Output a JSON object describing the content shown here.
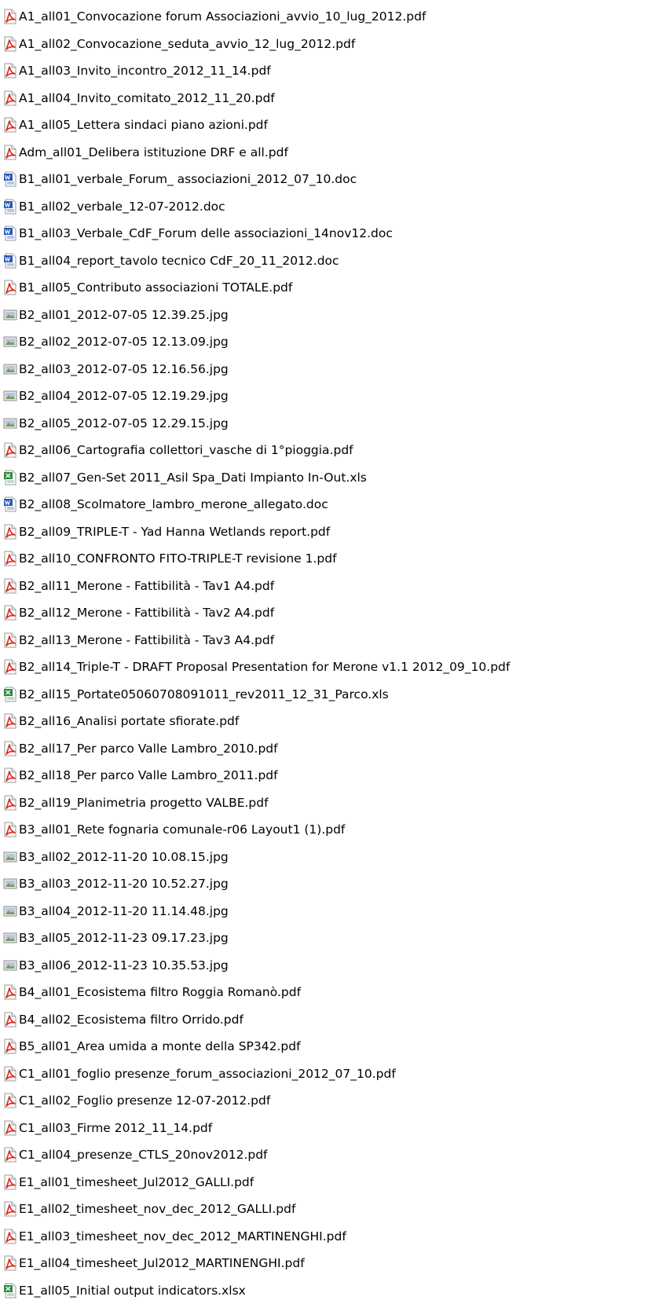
{
  "files": [
    {
      "name": "A1_all01_Convocazione forum Associazioni_avvio_10_lug_2012.pdf",
      "icon": "pdf-icon"
    },
    {
      "name": "A1_all02_Convocazione_seduta_avvio_12_lug_2012.pdf",
      "icon": "pdf-icon"
    },
    {
      "name": "A1_all03_Invito_incontro_2012_11_14.pdf",
      "icon": "pdf-icon"
    },
    {
      "name": "A1_all04_Invito_comitato_2012_11_20.pdf",
      "icon": "pdf-icon"
    },
    {
      "name": "A1_all05_Lettera sindaci piano azioni.pdf",
      "icon": "pdf-icon"
    },
    {
      "name": "Adm_all01_Delibera istituzione DRF e all.pdf",
      "icon": "pdf-icon"
    },
    {
      "name": "B1_all01_verbale_Forum_ associazioni_2012_07_10.doc",
      "icon": "word-doc-icon"
    },
    {
      "name": "B1_all02_verbale_12-07-2012.doc",
      "icon": "word-doc-icon"
    },
    {
      "name": "B1_all03_Verbale_CdF_Forum delle associazioni_14nov12.doc",
      "icon": "word-doc-icon"
    },
    {
      "name": "B1_all04_report_tavolo tecnico CdF_20_11_2012.doc",
      "icon": "word-doc-icon"
    },
    {
      "name": "B1_all05_Contributo associazioni TOTALE.pdf",
      "icon": "pdf-icon"
    },
    {
      "name": "B2_all01_2012-07-05 12.39.25.jpg",
      "icon": "image-icon"
    },
    {
      "name": "B2_all02_2012-07-05 12.13.09.jpg",
      "icon": "image-icon"
    },
    {
      "name": "B2_all03_2012-07-05 12.16.56.jpg",
      "icon": "image-icon"
    },
    {
      "name": "B2_all04_2012-07-05 12.19.29.jpg",
      "icon": "image-icon"
    },
    {
      "name": "B2_all05_2012-07-05 12.29.15.jpg",
      "icon": "image-icon"
    },
    {
      "name": "B2_all06_Cartografia collettori_vasche di 1°pioggia.pdf",
      "icon": "pdf-icon"
    },
    {
      "name": "B2_all07_Gen-Set 2011_Asil Spa_Dati Impianto In-Out.xls",
      "icon": "excel-icon"
    },
    {
      "name": "B2_all08_Scolmatore_lambro_merone_allegato.doc",
      "icon": "word-doc-icon"
    },
    {
      "name": "B2_all09_TRIPLE-T - Yad Hanna Wetlands report.pdf",
      "icon": "pdf-icon"
    },
    {
      "name": "B2_all10_CONFRONTO  FITO-TRIPLE-T  revisione 1.pdf",
      "icon": "pdf-icon"
    },
    {
      "name": "B2_all11_Merone - Fattibilità - Tav1 A4.pdf",
      "icon": "pdf-icon"
    },
    {
      "name": "B2_all12_Merone - Fattibilità - Tav2 A4.pdf",
      "icon": "pdf-icon"
    },
    {
      "name": "B2_all13_Merone - Fattibilità - Tav3 A4.pdf",
      "icon": "pdf-icon"
    },
    {
      "name": "B2_all14_Triple-T - DRAFT Proposal Presentation for Merone v1.1 2012_09_10.pdf",
      "icon": "pdf-icon"
    },
    {
      "name": "B2_all15_Portate05060708091011_rev2011_12_31_Parco.xls",
      "icon": "excel-icon"
    },
    {
      "name": "B2_all16_Analisi portate sfiorate.pdf",
      "icon": "pdf-icon"
    },
    {
      "name": "B2_all17_Per parco Valle Lambro_2010.pdf",
      "icon": "pdf-icon"
    },
    {
      "name": "B2_all18_Per parco Valle Lambro_2011.pdf",
      "icon": "pdf-icon"
    },
    {
      "name": "B2_all19_Planimetria progetto VALBE.pdf",
      "icon": "pdf-icon"
    },
    {
      "name": "B3_all01_Rete fognaria comunale-r06 Layout1 (1).pdf",
      "icon": "pdf-icon"
    },
    {
      "name": "B3_all02_2012-11-20 10.08.15.jpg",
      "icon": "image-icon"
    },
    {
      "name": "B3_all03_2012-11-20 10.52.27.jpg",
      "icon": "image-icon"
    },
    {
      "name": "B3_all04_2012-11-20 11.14.48.jpg",
      "icon": "image-icon"
    },
    {
      "name": "B3_all05_2012-11-23 09.17.23.jpg",
      "icon": "image-icon"
    },
    {
      "name": "B3_all06_2012-11-23 10.35.53.jpg",
      "icon": "image-icon"
    },
    {
      "name": "B4_all01_Ecosistema filtro Roggia Romanò.pdf",
      "icon": "pdf-icon"
    },
    {
      "name": "B4_all02_Ecosistema filtro Orrido.pdf",
      "icon": "pdf-icon"
    },
    {
      "name": "B5_all01_Area umida a monte della SP342.pdf",
      "icon": "pdf-icon"
    },
    {
      "name": "C1_all01_foglio presenze_forum_associazioni_2012_07_10.pdf",
      "icon": "pdf-icon"
    },
    {
      "name": "C1_all02_Foglio presenze 12-07-2012.pdf",
      "icon": "pdf-icon"
    },
    {
      "name": "C1_all03_Firme 2012_11_14.pdf",
      "icon": "pdf-icon"
    },
    {
      "name": "C1_all04_presenze_CTLS_20nov2012.pdf",
      "icon": "pdf-icon"
    },
    {
      "name": "E1_all01_timesheet_Jul2012_GALLI.pdf",
      "icon": "pdf-icon"
    },
    {
      "name": "E1_all02_timesheet_nov_dec_2012_GALLI.pdf",
      "icon": "pdf-icon"
    },
    {
      "name": "E1_all03_timesheet_nov_dec_2012_MARTINENGHI.pdf",
      "icon": "pdf-icon"
    },
    {
      "name": "E1_all04_timesheet_Jul2012_MARTINENGHI.pdf",
      "icon": "pdf-icon"
    },
    {
      "name": "E1_all05_Initial output indicators.xlsx",
      "icon": "excel-icon"
    }
  ],
  "colors": {
    "pdf_red": "#d8281c",
    "word_blue": "#2a5cb8",
    "excel_green": "#2e8b3a",
    "image_gray": "#8a8a8a"
  }
}
